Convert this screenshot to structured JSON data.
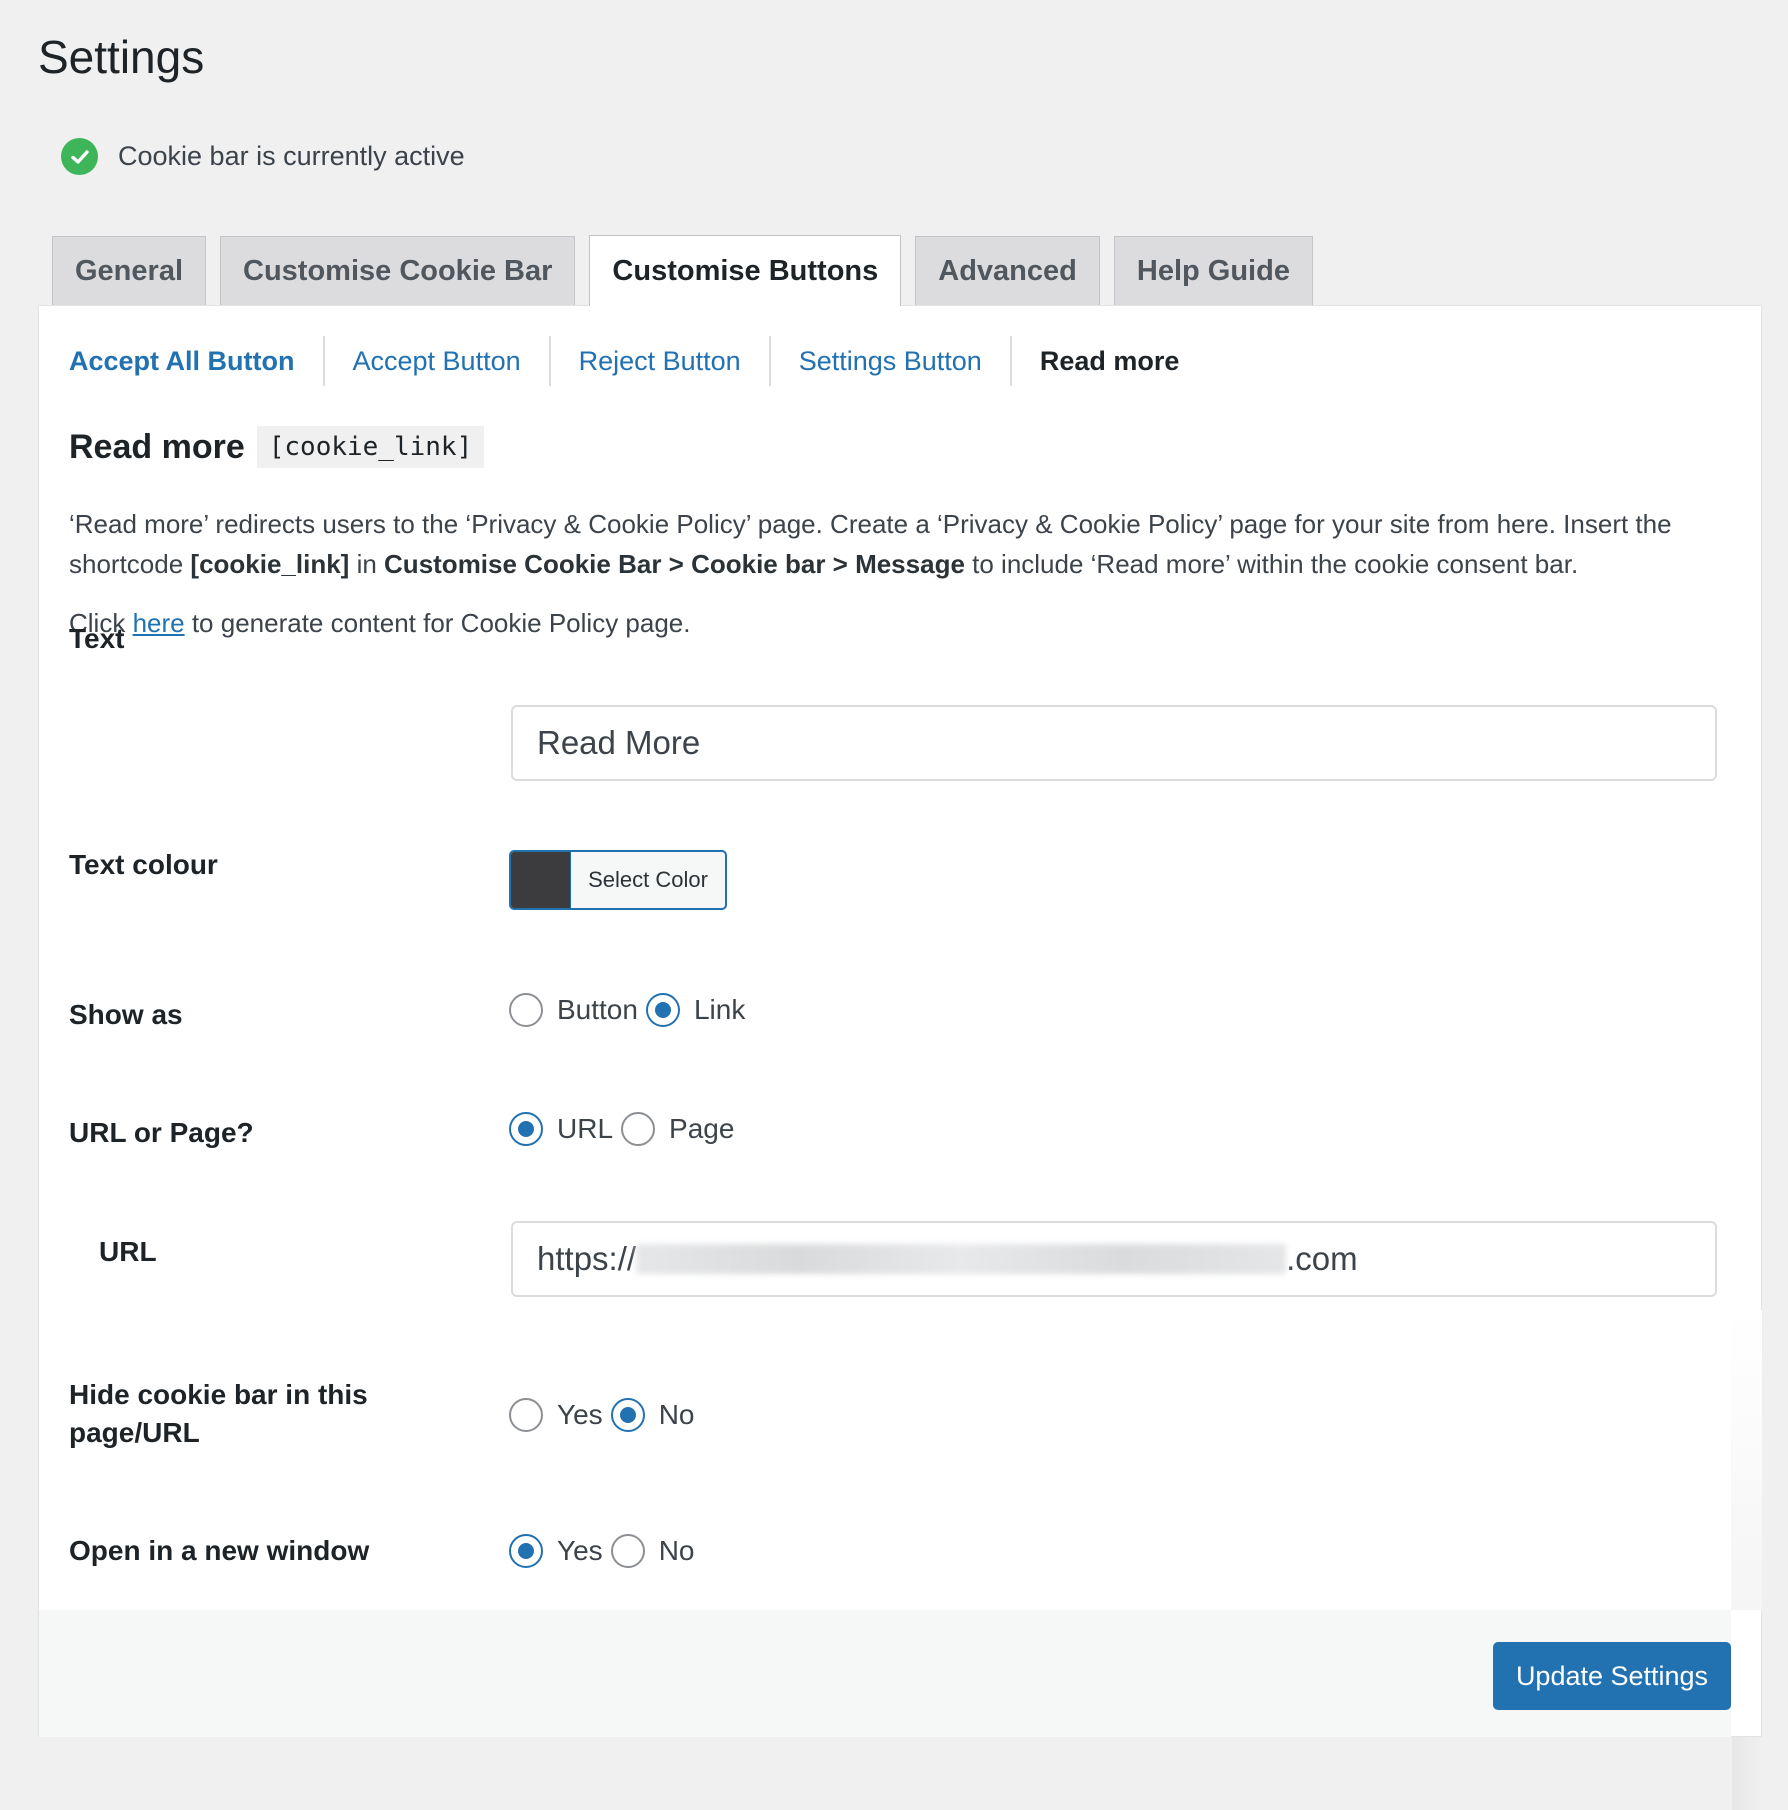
{
  "page": {
    "title": "Settings"
  },
  "notice": {
    "text": "Cookie bar is currently active",
    "color": "#3fb55a"
  },
  "tabs": [
    {
      "label": "General"
    },
    {
      "label": "Customise Cookie Bar"
    },
    {
      "label": "Customise Buttons",
      "active": true
    },
    {
      "label": "Advanced"
    },
    {
      "label": "Help Guide"
    }
  ],
  "subtabs": [
    {
      "label": "Accept All Button"
    },
    {
      "label": "Accept Button"
    },
    {
      "label": "Reject Button"
    },
    {
      "label": "Settings Button"
    },
    {
      "label": "Read more",
      "current": true
    }
  ],
  "section": {
    "title": "Read more",
    "shortcode": "[cookie_link]",
    "desc_part1": "‘Read more’ redirects users to the ‘Privacy & Cookie Policy’ page. Create a ‘Privacy & Cookie Policy’ page for your site from here. Insert the shortcode ",
    "desc_bold1": "[cookie_link]",
    "desc_part2": " in ",
    "desc_bold2": "Customise Cookie Bar > Cookie bar > Message",
    "desc_part3": " to include ‘Read more’ within the cookie consent bar.",
    "click_prefix": "Click ",
    "click_link": "here",
    "click_suffix": " to generate content for Cookie Policy page."
  },
  "form": {
    "text": {
      "label": "Text",
      "value": "Read More"
    },
    "text_colour": {
      "label": "Text colour",
      "button": "Select Color",
      "swatch": "#3c3c3e"
    },
    "show_as": {
      "label": "Show as",
      "options": [
        "Button",
        "Link"
      ],
      "selected": "Link"
    },
    "url_or_page": {
      "label": "URL or Page?",
      "options": [
        "URL",
        "Page"
      ],
      "selected": "URL"
    },
    "url": {
      "label": "URL",
      "prefix": "https://",
      "suffix": ".com"
    },
    "hide_bar": {
      "label": "Hide cookie bar in this page/URL",
      "options": [
        "Yes",
        "No"
      ],
      "selected": "No"
    },
    "new_window": {
      "label": "Open in a new window",
      "options": [
        "Yes",
        "No"
      ],
      "selected": "Yes"
    }
  },
  "footer": {
    "update_label": "Update Settings",
    "accent": "#2271b1"
  }
}
